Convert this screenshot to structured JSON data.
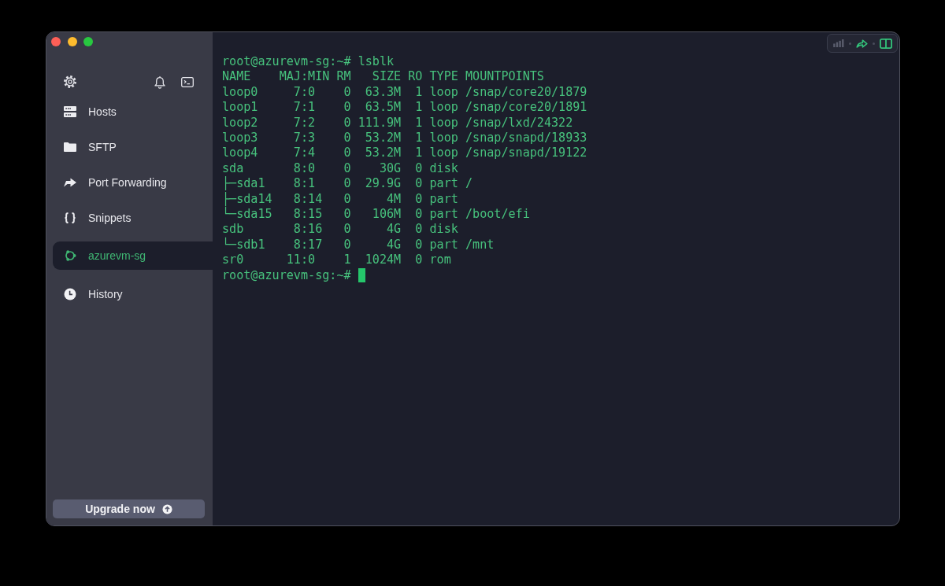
{
  "sidebar": {
    "items": [
      {
        "label": "Hosts",
        "selected": false
      },
      {
        "label": "SFTP",
        "selected": false
      },
      {
        "label": "Port Forwarding",
        "selected": false
      },
      {
        "label": "Snippets",
        "selected": false
      },
      {
        "label": "azurevm-sg",
        "selected": true
      },
      {
        "label": "History",
        "selected": false
      }
    ]
  },
  "upgrade_button": {
    "label": "Upgrade now"
  },
  "terminal": {
    "lines": [
      "root@azurevm-sg:~# lsblk",
      "NAME    MAJ:MIN RM   SIZE RO TYPE MOUNTPOINTS",
      "loop0     7:0    0  63.3M  1 loop /snap/core20/1879",
      "loop1     7:1    0  63.5M  1 loop /snap/core20/1891",
      "loop2     7:2    0 111.9M  1 loop /snap/lxd/24322",
      "loop3     7:3    0  53.2M  1 loop /snap/snapd/18933",
      "loop4     7:4    0  53.2M  1 loop /snap/snapd/19122",
      "sda       8:0    0    30G  0 disk",
      "├─sda1    8:1    0  29.9G  0 part /",
      "├─sda14   8:14   0     4M  0 part",
      "└─sda15   8:15   0   106M  0 part /boot/efi",
      "sdb       8:16   0     4G  0 disk",
      "└─sdb1    8:17   0     4G  0 part /mnt",
      "sr0      11:0    1  1024M  0 rom"
    ],
    "prompt": "root@azurevm-sg:~#",
    "cursor": true
  }
}
